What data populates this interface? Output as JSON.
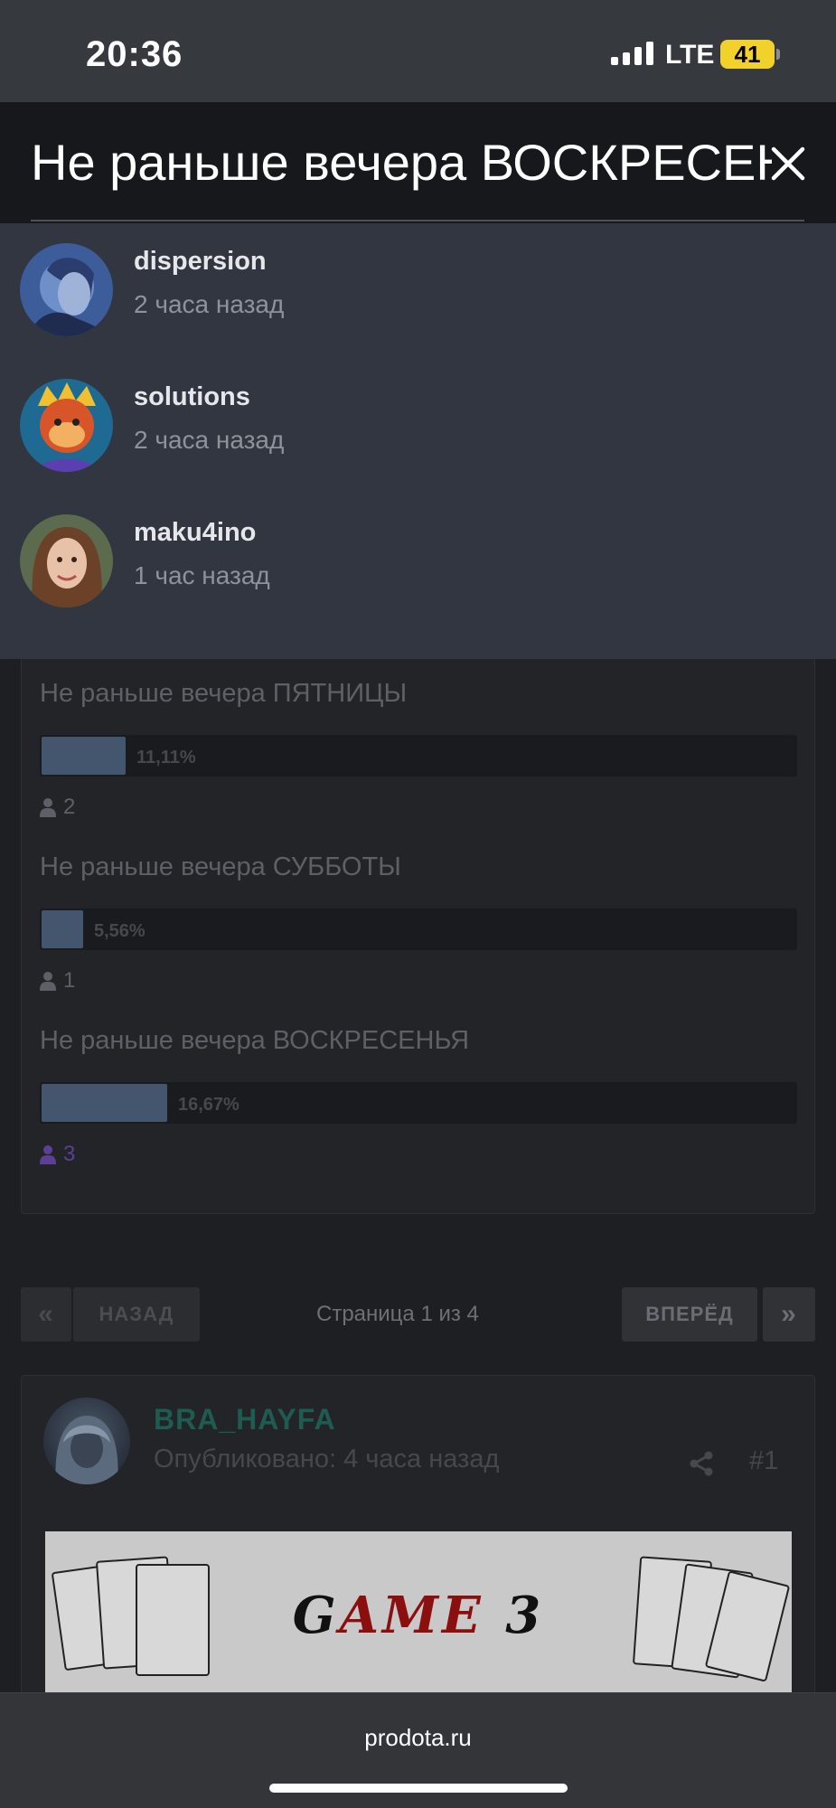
{
  "status_bar": {
    "time": "20:36",
    "network": "LTE",
    "battery": "41"
  },
  "modal": {
    "title": "Не раньше вечера ВОСКРЕСЕНЬЯ",
    "voters": [
      {
        "name": "dispersion",
        "time": "2 часа назад"
      },
      {
        "name": "solutions",
        "time": "2 часа назад"
      },
      {
        "name": "maku4ino",
        "time": "1 час назад"
      }
    ]
  },
  "poll": {
    "options": [
      {
        "label": "Не раньше вечера ПЯТНИЦЫ",
        "percent_text": "11,11%",
        "percent": 11.11,
        "votes": "2",
        "voted": false
      },
      {
        "label": "Не раньше вечера СУББОТЫ",
        "percent_text": "5,56%",
        "percent": 5.56,
        "votes": "1",
        "voted": false
      },
      {
        "label": "Не раньше вечера ВОСКРЕСЕНЬЯ",
        "percent_text": "16,67%",
        "percent": 16.67,
        "votes": "3",
        "voted": true
      }
    ]
  },
  "pagination": {
    "prev_label": "НАЗАД",
    "info": "Страница 1 из 4",
    "next_label": "ВПЕРЁД",
    "first_icon": "«",
    "last_icon": "»"
  },
  "post": {
    "author": "BRA_HAYFA",
    "published": "Опубликовано: 4 часа назад",
    "number": "#1",
    "image_title_a": "G",
    "image_title_b": "AME",
    "image_title_c": " 3"
  },
  "browser": {
    "url": "prodota.ru"
  },
  "colors": {
    "poll_fill": "#43566e",
    "voted_purple": "#5c3f97",
    "author_green": "#1e5b50",
    "battery_yellow": "#f3d12b"
  }
}
